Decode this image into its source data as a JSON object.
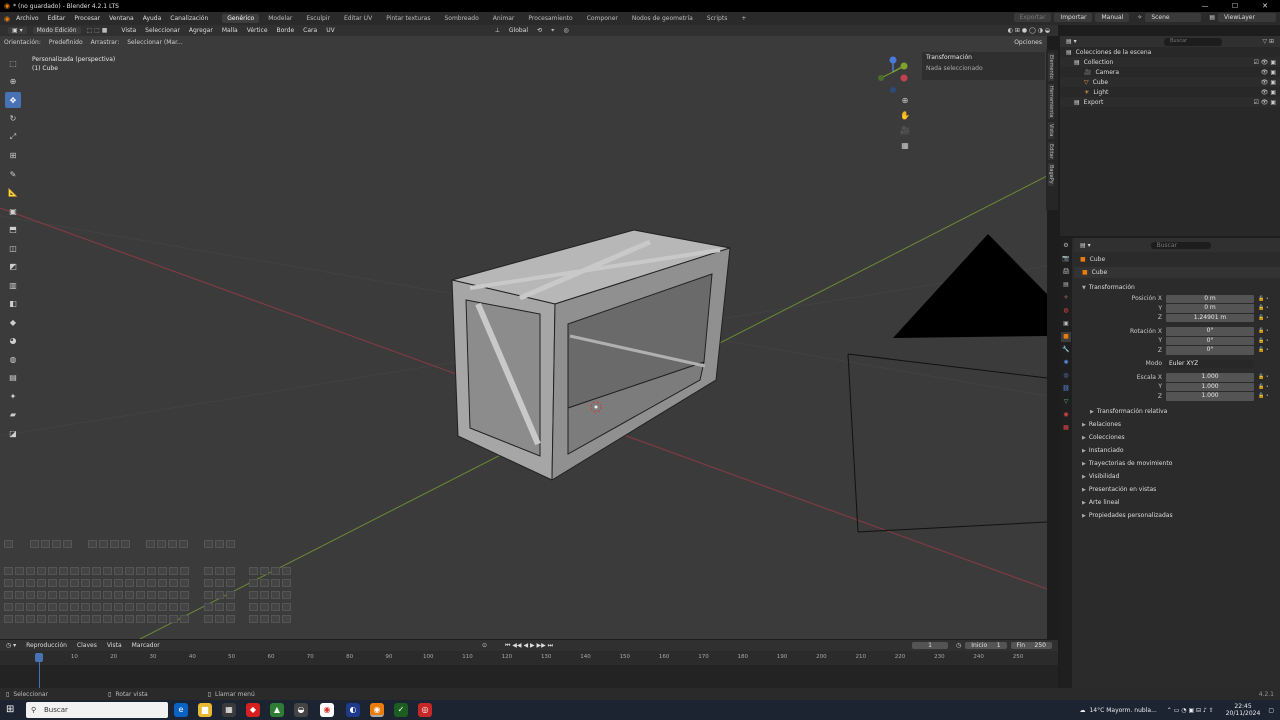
{
  "window": {
    "title": "* (no guardado) - Blender 4.2.1 LTS"
  },
  "menubar": {
    "menus": [
      "Archivo",
      "Editar",
      "Procesar",
      "Ventana",
      "Ayuda",
      "Canalización"
    ],
    "workspaces": [
      "Genérico",
      "Modelar",
      "Esculpir",
      "Editar UV",
      "Pintar texturas",
      "Sombreado",
      "Animar",
      "Procesamiento",
      "Componer",
      "Nodos de geometría",
      "Scripts"
    ],
    "active_workspace": "Genérico",
    "add_tab": "+",
    "exportar": "Exportar",
    "importar": "Importar",
    "manual": "Manual",
    "scene": "Scene",
    "view_layer": "ViewLayer"
  },
  "viewport_header": {
    "mode": "Modo Edición",
    "menus": [
      "Vista",
      "Seleccionar",
      "Agregar",
      "Malla",
      "Vértice",
      "Borde",
      "Cara",
      "UV"
    ],
    "orientation_space": "Global"
  },
  "tool_header": {
    "orientation_label": "Orientación:",
    "orientation_value": "Predefinido",
    "drag_label": "Arrastrar:",
    "drag_value": "Seleccionar (Mar...",
    "options": "Opciones"
  },
  "viewport": {
    "view_name": "Personalizada (perspectiva)",
    "object_label": "(1) Cube"
  },
  "npanel": {
    "header": "Transformación",
    "body": "Nada seleccionado",
    "tabs": [
      "Elemento",
      "Herramienta",
      "Vista",
      "Editar",
      "BagaPy"
    ]
  },
  "outliner": {
    "search_placeholder": "Buscar",
    "rows": [
      "Colecciones de la escena",
      "Collection",
      "Camera",
      "Cube",
      "Light",
      "Export"
    ]
  },
  "properties": {
    "search_placeholder": "Buscar",
    "object_name": "Cube",
    "object_datablock": "Cube",
    "transform_title": "Transformación",
    "location": {
      "label_x": "Posición X",
      "label_y": "Y",
      "label_z": "Z",
      "x": "0 m",
      "y": "0 m",
      "z": "1.24901 m"
    },
    "rotation": {
      "label_x": "Rotación X",
      "label_y": "Y",
      "label_z": "Z",
      "x": "0°",
      "y": "0°",
      "z": "0°"
    },
    "mode": {
      "label": "Modo",
      "value": "Euler XYZ"
    },
    "scale": {
      "label_x": "Escala X",
      "label_y": "Y",
      "label_z": "Z",
      "x": "1.000",
      "y": "1.000",
      "z": "1.000"
    },
    "sections": [
      "Transformación relativa",
      "Relaciones",
      "Colecciones",
      "Instanciado",
      "Trayectorias de movimiento",
      "Visibilidad",
      "Presentación en vistas",
      "Arte lineal",
      "Propiedades personalizadas"
    ]
  },
  "timeline": {
    "menus": [
      "Reproducción",
      "Claves",
      "Vista",
      "Marcador"
    ],
    "current_frame": "1",
    "start_label": "Inicio",
    "start": "1",
    "end_label": "Fin",
    "end": "250",
    "ticks": [
      "1",
      "10",
      "20",
      "30",
      "40",
      "50",
      "60",
      "70",
      "80",
      "90",
      "100",
      "110",
      "120",
      "130",
      "140",
      "150",
      "160",
      "170",
      "180",
      "190",
      "200",
      "210",
      "220",
      "230",
      "240",
      "250"
    ]
  },
  "statusbar": {
    "items": [
      "Seleccionar",
      "Rotar vista",
      "Llamar menú"
    ],
    "version": "4.2.1"
  },
  "taskbar": {
    "search": "Buscar",
    "weather": "14°C  Mayorm. nubla...",
    "time": "22:45",
    "date": "20/11/2024"
  },
  "colors": {
    "accent": "#4772b3",
    "blender_orange": "#e87d0d",
    "x_axis": "#c24050",
    "y_axis": "#7ea32d"
  }
}
